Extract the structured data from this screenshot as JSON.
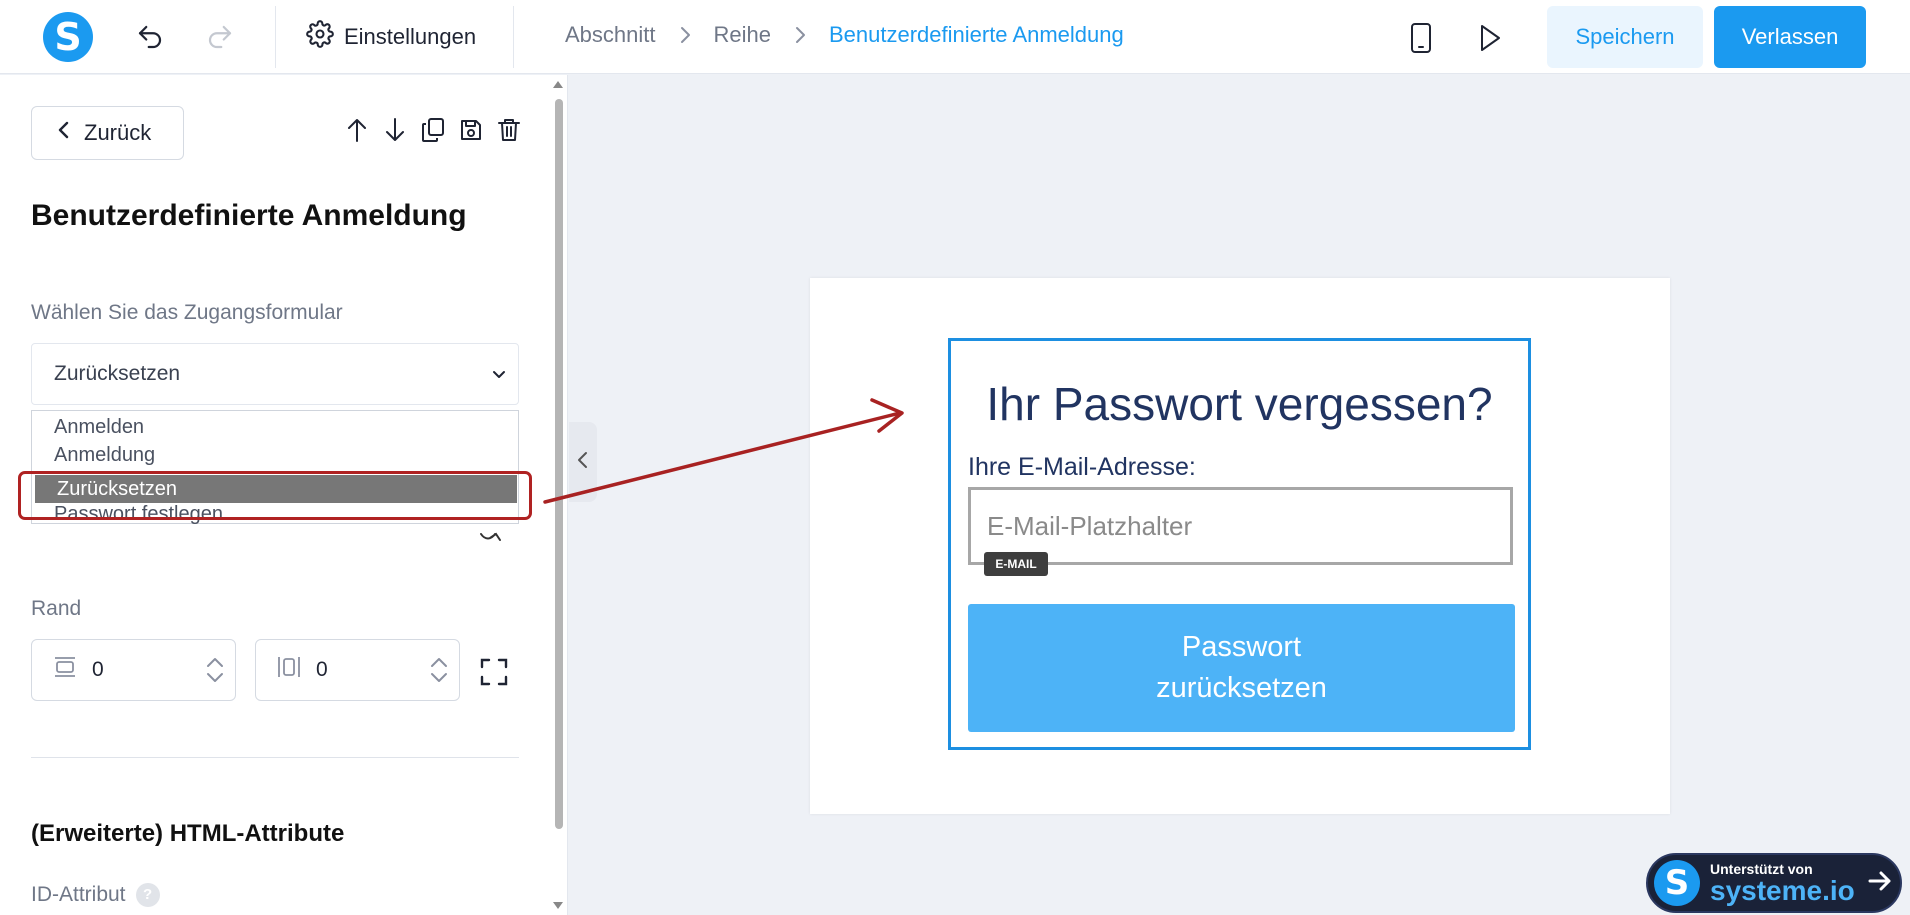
{
  "topbar": {
    "settings_label": "Einstellungen",
    "breadcrumbs": [
      "Abschnitt",
      "Reihe",
      "Benutzerdefinierte Anmeldung"
    ],
    "save_label": "Speichern",
    "exit_label": "Verlassen",
    "logo_letter": "S"
  },
  "sidebar": {
    "back_label": "Zurück",
    "title": "Benutzerdefinierte Anmeldung",
    "form_label": "Wählen Sie das Zugangsformular",
    "select_value": "Zurücksetzen",
    "options": [
      "Anmelden",
      "Anmeldung",
      "Zurücksetzen",
      "Passwort festlegen"
    ],
    "rand_label": "Rand",
    "margin_horizontal": "0",
    "margin_vertical": "0",
    "advanced_title": "(Erweiterte) HTML-Attribute",
    "id_label": "ID-Attribut",
    "help_glyph": "?"
  },
  "canvas": {
    "form_title": "Ihr Passwort vergessen?",
    "email_label": "Ihre E-Mail-Adresse:",
    "email_placeholder": "E-Mail-Platzhalter",
    "email_tag": "E-MAIL",
    "reset_button": "Passwort zurücksetzen"
  },
  "badge": {
    "top_text": "Unterstützt von",
    "brand": "systeme.io",
    "logo_letter": "S"
  },
  "colors": {
    "accent": "#1b9af0",
    "highlight": "#b02222",
    "button": "#4db3f7",
    "title": "#213461"
  }
}
